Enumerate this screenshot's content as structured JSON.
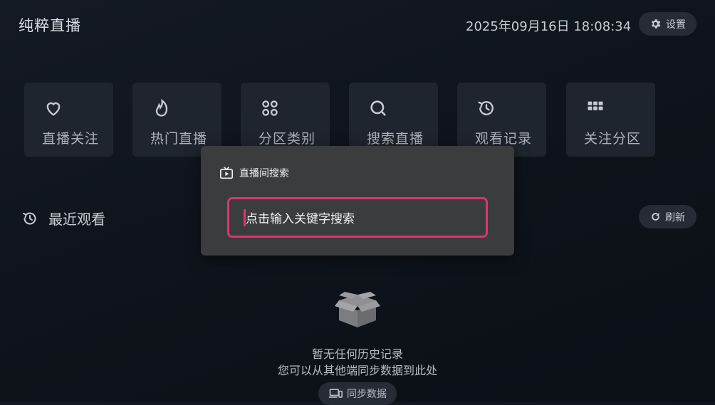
{
  "header": {
    "app_title": "纯粹直播",
    "datetime": "2025年09月16日 18:08:34",
    "settings_label": "设置"
  },
  "tiles": [
    {
      "label": "直播关注",
      "icon": "heart-icon"
    },
    {
      "label": "热门直播",
      "icon": "flame-icon"
    },
    {
      "label": "分区类别",
      "icon": "category-icon"
    },
    {
      "label": "搜索直播",
      "icon": "search-icon"
    },
    {
      "label": "观看记录",
      "icon": "history-icon"
    },
    {
      "label": "关注分区",
      "icon": "grid-icon"
    }
  ],
  "recent": {
    "title": "最近观看",
    "refresh_label": "刷新",
    "empty_title": "暂无任何历史记录",
    "empty_subtitle": "您可以从其他端同步数据到此处",
    "sync_label": "同步数据"
  },
  "dialog": {
    "title": "直播间搜索",
    "search_placeholder": "点击输入关键字搜索"
  },
  "colors": {
    "accent": "#e0336c",
    "background": "#0f141c",
    "tile": "#1f252e",
    "dialog": "#3b3c3e"
  }
}
